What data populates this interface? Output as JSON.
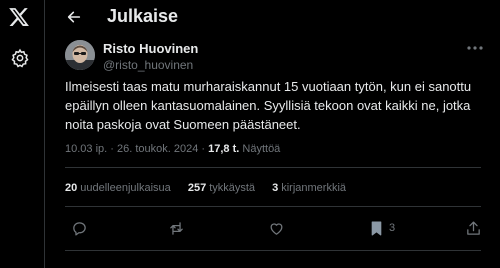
{
  "app": {
    "logo_icon": "x-logo-icon",
    "settings_icon": "gear-icon"
  },
  "header": {
    "title": "Julkaise",
    "back_icon": "back-arrow-icon"
  },
  "author": {
    "name": "Risto Huovinen",
    "handle": "@risto_huovinen"
  },
  "tweet": {
    "text": "Ilmeisesti taas matu murharaiskannut 15 vuotiaan tytön, kun ei sanottu epäillyn olleen kantasuomalainen. Syyllisiä tekoon ovat kaikki ne, jotka noita paskoja ovat Suomeen päästäneet."
  },
  "meta": {
    "time": "10.03 ip.",
    "separator": "·",
    "date": "26. toukok. 2024",
    "separator2": "·",
    "views_count": "17,8 t.",
    "views_label": "Näyttöä"
  },
  "stats": {
    "reposts_count": "20",
    "reposts_label": "uudelleenjulkaisua",
    "likes_count": "257",
    "likes_label": "tykkäystä",
    "bookmarks_count": "3",
    "bookmarks_label": "kirjanmerkkiä"
  },
  "actions": {
    "reply_icon": "reply-icon",
    "repost_icon": "repost-icon",
    "like_icon": "heart-icon",
    "bookmark_icon": "bookmark-icon",
    "bookmark_count": "3",
    "share_icon": "share-icon"
  },
  "colors": {
    "background": "#000000",
    "text": "#e7e9ea",
    "muted": "#71767b",
    "divider": "#2f3336"
  }
}
